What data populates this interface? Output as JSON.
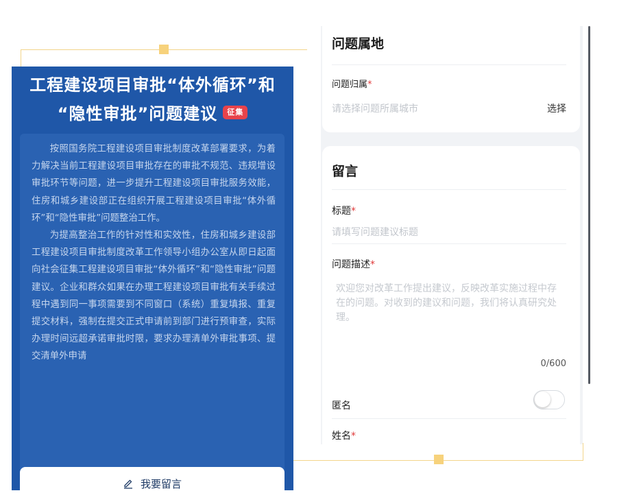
{
  "left": {
    "title_line1": "工程建设项目审批“体外循环”和",
    "title_line2": "“隐性审批”问题建议",
    "tag": "征集",
    "paragraphs": [
      "按照国务院工程建设项目审批制度改革部署要求，为着力解决当前工程建设项目审批存在的审批不规范、违规增设审批环节等问题，进一步提升工程建设项目审批服务效能，住房和城乡建设部正在组织开展工程建设项目审批“体外循环”和“隐性审批”问题整治工作。",
      "为提高整治工作的针对性和实效性，住房和城乡建设部工程建设项目审批制度改革工作领导小组办公室从即日起面向社会征集工程建设项目审批“体外循环”和“隐性审批”问题建议。企业和群众如果在办理工程建设项目审批有关手续过程中遇到同一事项需要到不同窗口（系统）重复填报、重复提交材料，强制在提交正式申请前到部门进行预审查，实际办理时间远超承诺审批时限，要求办理清单外审批事项、提交清单外申请"
    ],
    "button_label": "我要留言",
    "button_icon": "pen-icon"
  },
  "right": {
    "location": {
      "section_title": "问题属地",
      "field_label": "问题归属",
      "required_mark": "*",
      "placeholder": "请选择问题所属城市",
      "choose_label": "选择"
    },
    "message": {
      "section_title": "留言",
      "title_label": "标题",
      "title_placeholder": "请填写问题建议标题",
      "desc_label": "问题描述",
      "desc_placeholder": "欢迎您对改革工作提出建议，反映改革实施过程中存在的问题。对收到的建议和问题，我们将认真研究处理。",
      "counter": "0/600",
      "anonymous_label": "匿名",
      "anonymous_on": false,
      "name_label": "姓名",
      "required_mark": "*"
    }
  },
  "colors": {
    "left_bg": "#1f57a8",
    "tag_bg": "#e8434b",
    "frame": "#f3d58a",
    "required": "#e03a3a"
  }
}
